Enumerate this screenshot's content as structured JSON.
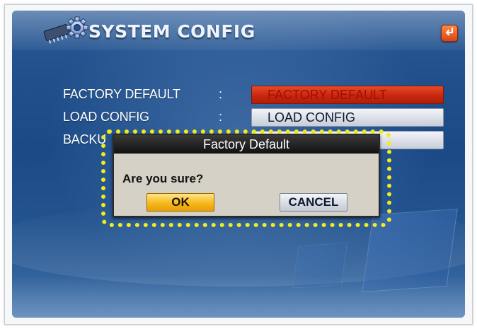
{
  "window": {
    "title": "SYSTEM CONFIG",
    "title_icon": "gear-icon",
    "return_icon": "return-icon"
  },
  "settings": [
    {
      "label": "FACTORY DEFAULT",
      "separator": ":",
      "button_label": "FACTORY DEFAULT",
      "state": "selected"
    },
    {
      "label": "LOAD CONFIG",
      "separator": ":",
      "button_label": "LOAD CONFIG",
      "state": "normal"
    },
    {
      "label": "BACKU",
      "separator": "",
      "button_label": "",
      "state": "normal"
    }
  ],
  "dialog": {
    "title": "Factory Default",
    "message": "Are you sure?",
    "ok_label": "OK",
    "cancel_label": "CANCEL"
  },
  "colors": {
    "selected_button": "#c8260e",
    "ok_button": "#f6b91a",
    "highlight_outline": "#f2ec1a",
    "screen_background": "#1b4a87"
  }
}
